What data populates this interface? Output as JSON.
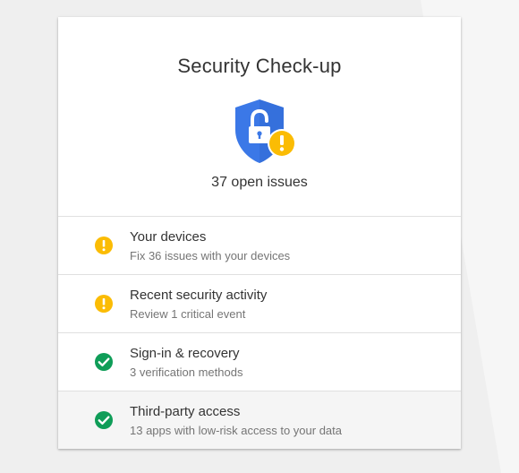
{
  "card": {
    "title": "Security Check-up",
    "status": "37 open issues"
  },
  "colors": {
    "shield_blue": "#3b78e7",
    "warning_yellow": "#fbbc04",
    "ok_green": "#0f9d58"
  },
  "items": [
    {
      "title": "Your devices",
      "subtitle": "Fix 36 issues with your devices",
      "status": "warning"
    },
    {
      "title": "Recent security activity",
      "subtitle": "Review 1 critical event",
      "status": "warning"
    },
    {
      "title": "Sign-in & recovery",
      "subtitle": "3 verification methods",
      "status": "ok"
    },
    {
      "title": "Third-party access",
      "subtitle": "13 apps with low-risk access to your data",
      "status": "ok"
    }
  ]
}
